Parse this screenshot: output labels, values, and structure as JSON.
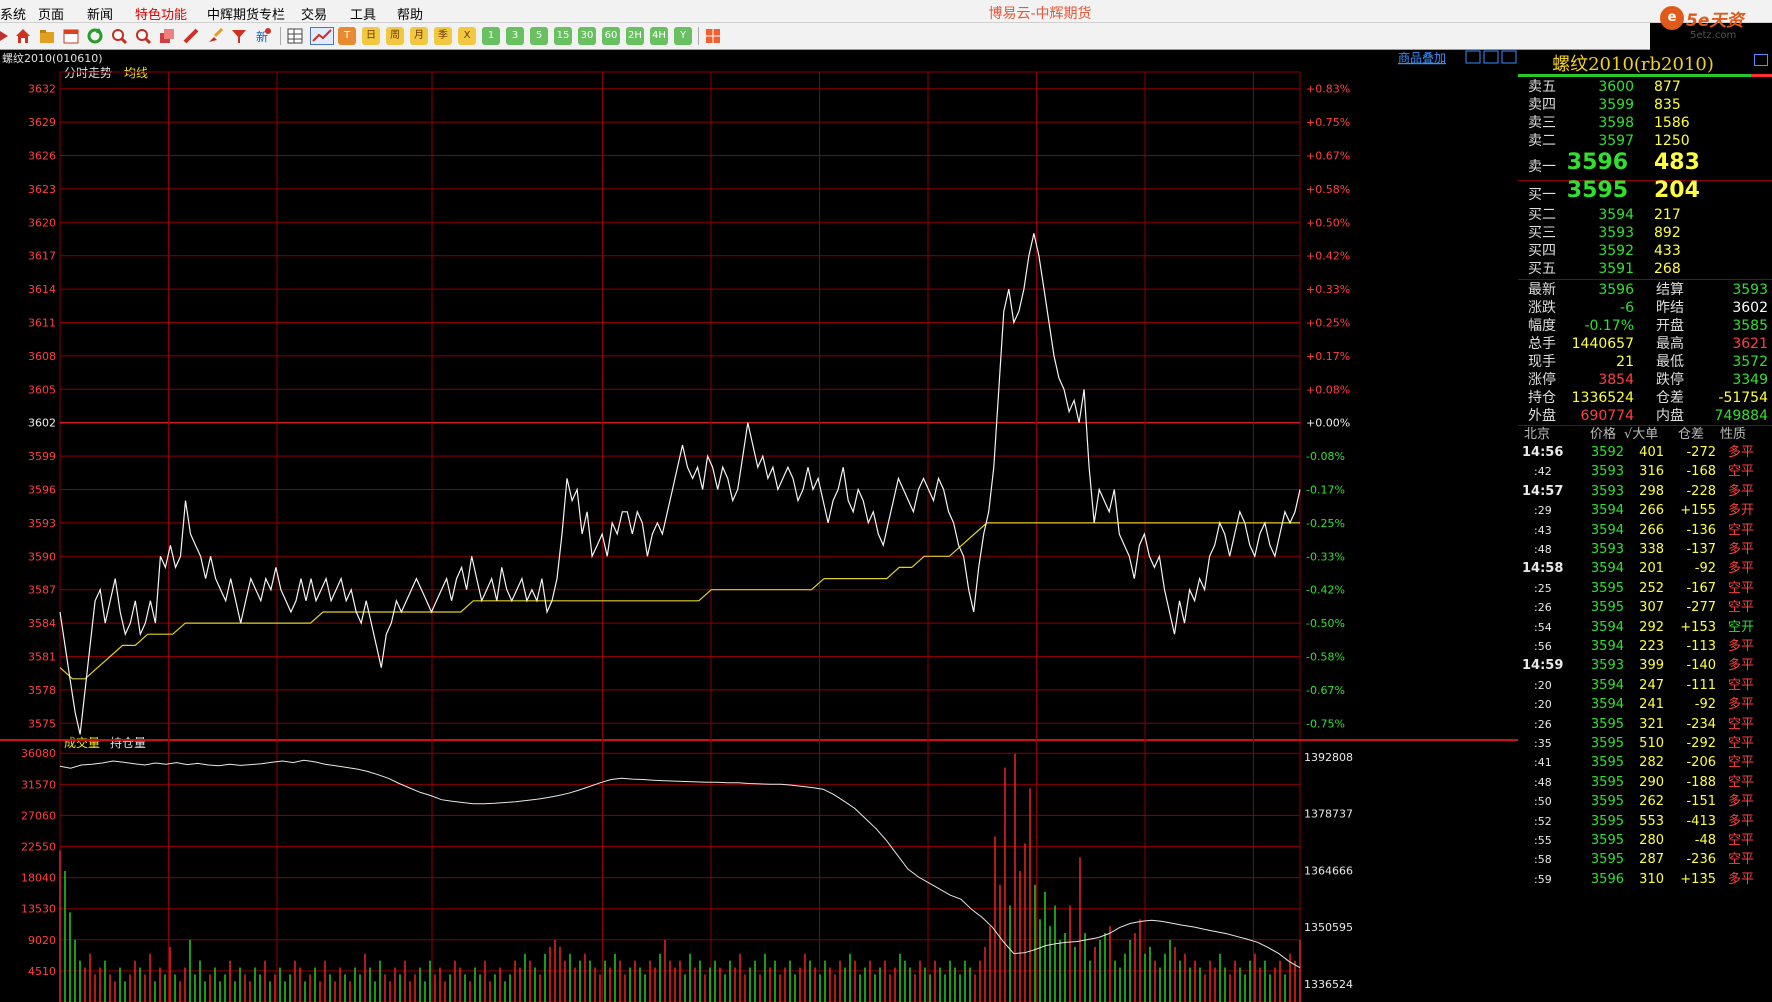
{
  "window": {
    "title": "博易云-中辉期货",
    "logo": {
      "main": "5e天资",
      "url": "5etz.com"
    }
  },
  "menu": [
    "系统",
    "页面",
    "新闻",
    "特色功能",
    "中辉期货专栏",
    "交易",
    "工具",
    "帮助"
  ],
  "toolbar": {
    "icons": [
      "home-icon",
      "folder-icon",
      "calendar-icon",
      "refresh-icon",
      "zoom-in-icon",
      "zoom-out-icon",
      "stack-icon",
      "pencil-icon",
      "brush-icon",
      "filter-icon",
      "new-icon",
      "table-icon",
      "trend-icon",
      "tick-icon"
    ],
    "periods": [
      "日",
      "周",
      "月",
      "季",
      "X",
      "1",
      "3",
      "5",
      "15",
      "30",
      "60",
      "2H",
      "4H",
      "Y"
    ]
  },
  "chart": {
    "contract_label": "螺纹2010(010610)",
    "overlay_link": "商品叠加",
    "price_legend": "分时走势",
    "avg_legend": "均线",
    "vol_legend": "成交量",
    "oi_legend": "持仓量",
    "price_ticks": [
      "3632",
      "3629",
      "3626",
      "3623",
      "3620",
      "3617",
      "3614",
      "3611",
      "3608",
      "3605",
      "3602",
      "3599",
      "3596",
      "3593",
      "3590",
      "3587",
      "3584",
      "3581",
      "3578",
      "3575"
    ],
    "pct_ticks": [
      "+0.83%",
      "+0.75%",
      "+0.67%",
      "+0.58%",
      "+0.50%",
      "+0.42%",
      "+0.33%",
      "+0.25%",
      "+0.17%",
      "+0.08%",
      "+0.00%",
      "-0.08%",
      "-0.17%",
      "-0.25%",
      "-0.33%",
      "-0.42%",
      "-0.50%",
      "-0.58%",
      "-0.67%",
      "-0.75%"
    ],
    "vol_ticks": [
      "36080",
      "31570",
      "27060",
      "22550",
      "18040",
      "13530",
      "9020",
      "4510"
    ],
    "oi_ticks": [
      "1392808",
      "1378737",
      "1364666",
      "1350595",
      "1336524"
    ]
  },
  "chart_data": {
    "type": "line",
    "ylim": [
      3573.5,
      3633.5
    ],
    "prev_settle": 3602,
    "price": [
      3585,
      3582,
      3579,
      3576,
      3574,
      3578,
      3582,
      3586,
      3587,
      3584,
      3586,
      3588,
      3585,
      3583,
      3584,
      3586,
      3583,
      3584,
      3586,
      3584,
      3590,
      3589,
      3591,
      3589,
      3590,
      3595,
      3592,
      3591,
      3590,
      3588,
      3590,
      3588,
      3587,
      3586,
      3588,
      3586,
      3584,
      3586,
      3588,
      3587,
      3586,
      3588,
      3587,
      3589,
      3587,
      3586,
      3585,
      3586,
      3588,
      3586,
      3588,
      3586,
      3587,
      3588,
      3586,
      3587,
      3588,
      3586,
      3587,
      3585,
      3584,
      3586,
      3584,
      3582,
      3580,
      3583,
      3584,
      3586,
      3585,
      3586,
      3587,
      3588,
      3587,
      3586,
      3585,
      3586,
      3587,
      3588,
      3586,
      3588,
      3589,
      3587,
      3590,
      3588,
      3586,
      3587,
      3588,
      3586,
      3589,
      3587,
      3586,
      3587,
      3588,
      3586,
      3587,
      3586,
      3588,
      3585,
      3586,
      3588,
      3592,
      3597,
      3595,
      3596,
      3592,
      3594,
      3590,
      3591,
      3592,
      3590,
      3593,
      3592,
      3594,
      3594,
      3592,
      3594,
      3593,
      3590,
      3592,
      3593,
      3592,
      3594,
      3596,
      3598,
      3600,
      3598,
      3597,
      3598,
      3596,
      3599,
      3598,
      3596,
      3598,
      3597,
      3595,
      3596,
      3599,
      3602,
      3600,
      3598,
      3599,
      3597,
      3598,
      3596,
      3597,
      3598,
      3597,
      3595,
      3596,
      3598,
      3596,
      3597,
      3595,
      3593,
      3595,
      3596,
      3598,
      3595,
      3594,
      3596,
      3595,
      3593,
      3594,
      3592,
      3591,
      3593,
      3595,
      3597,
      3596,
      3595,
      3594,
      3596,
      3597,
      3596,
      3595,
      3597,
      3596,
      3594,
      3593,
      3591,
      3590,
      3587,
      3585,
      3589,
      3592,
      3594,
      3598,
      3605,
      3612,
      3614,
      3611,
      3612,
      3614,
      3617,
      3619,
      3617,
      3614,
      3611,
      3608,
      3606,
      3605,
      3603,
      3604,
      3602,
      3605,
      3598,
      3593,
      3596,
      3595,
      3594,
      3596,
      3592,
      3591,
      3590,
      3588,
      3591,
      3592,
      3590,
      3589,
      3590,
      3587,
      3585,
      3583,
      3586,
      3584,
      3587,
      3586,
      3588,
      3587,
      3590,
      3591,
      3593,
      3592,
      3590,
      3592,
      3594,
      3593,
      3591,
      3590,
      3592,
      3593,
      3591,
      3590,
      3592,
      3594,
      3593,
      3594,
      3596
    ],
    "avg": [
      3580,
      3579,
      3579,
      3580,
      3581,
      3582,
      3582,
      3583,
      3583,
      3583,
      3584,
      3584,
      3584,
      3584,
      3584,
      3584,
      3584,
      3584,
      3584,
      3584,
      3584,
      3585,
      3585,
      3585,
      3585,
      3585,
      3585,
      3585,
      3585,
      3585,
      3585,
      3585,
      3585,
      3586,
      3586,
      3586,
      3586,
      3586,
      3586,
      3586,
      3586,
      3586,
      3586,
      3586,
      3586,
      3586,
      3586,
      3586,
      3586,
      3586,
      3586,
      3586,
      3587,
      3587,
      3587,
      3587,
      3587,
      3587,
      3587,
      3587,
      3587,
      3588,
      3588,
      3588,
      3588,
      3588,
      3588,
      3589,
      3589,
      3590,
      3590,
      3590,
      3591,
      3592,
      3593,
      3593,
      3593,
      3593,
      3593,
      3593,
      3593,
      3593,
      3593,
      3593,
      3593,
      3593,
      3593,
      3593,
      3593,
      3593,
      3593,
      3593,
      3593,
      3593,
      3593,
      3593,
      3593,
      3593,
      3593,
      3593
    ],
    "vol_ylim": [
      0,
      38000
    ],
    "volume": [
      22000,
      19000,
      13000,
      9000,
      6000,
      5000,
      7000,
      4000,
      5000,
      6000,
      4000,
      3000,
      5000,
      3000,
      4000,
      6000,
      5000,
      4000,
      7000,
      3000,
      5000,
      4000,
      8000,
      4000,
      3000,
      5000,
      9000,
      4000,
      6000,
      3000,
      4000,
      5000,
      3000,
      4000,
      6000,
      3000,
      5000,
      4000,
      3000,
      5000,
      4000,
      6000,
      3000,
      4000,
      5000,
      3000,
      4000,
      6000,
      5000,
      3000,
      4000,
      5000,
      3000,
      6000,
      4000,
      3000,
      5000,
      4000,
      3000,
      5000,
      4000,
      7000,
      5000,
      3000,
      6000,
      4000,
      3000,
      5000,
      4000,
      6000,
      3000,
      4000,
      5000,
      3000,
      6000,
      4000,
      5000,
      3000,
      4000,
      6000,
      5000,
      4000,
      3000,
      5000,
      4000,
      6000,
      3000,
      4000,
      5000,
      3000,
      4000,
      6000,
      5000,
      7000,
      6000,
      5000,
      4000,
      7000,
      8000,
      9000,
      8000,
      6000,
      7000,
      5000,
      6000,
      7000,
      6000,
      5000,
      4000,
      6000,
      5000,
      7000,
      6000,
      4000,
      5000,
      6000,
      5000,
      4000,
      6000,
      5000,
      7000,
      9000,
      6000,
      5000,
      6000,
      4000,
      7000,
      5000,
      6000,
      4000,
      5000,
      6000,
      5000,
      4000,
      6000,
      5000,
      7000,
      4000,
      5000,
      6000,
      4000,
      7000,
      5000,
      6000,
      4000,
      5000,
      6000,
      4000,
      5000,
      7000,
      6000,
      5000,
      4000,
      6000,
      5000,
      4000,
      6000,
      5000,
      7000,
      6000,
      4000,
      5000,
      6000,
      4000,
      5000,
      6000,
      4000,
      5000,
      7000,
      6000,
      5000,
      4000,
      6000,
      5000,
      4000,
      6000,
      5000,
      4000,
      6000,
      5000,
      4000,
      6000,
      5000,
      4000,
      6000,
      8000,
      11000,
      24000,
      17000,
      34000,
      14000,
      36000,
      19000,
      23000,
      31000,
      17000,
      12000,
      16000,
      11000,
      14000,
      9000,
      10000,
      14000,
      8000,
      21000,
      10000,
      6000,
      8000,
      9000,
      10000,
      11000,
      6000,
      5000,
      7000,
      9000,
      10000,
      12000,
      7000,
      8000,
      6000,
      5000,
      7000,
      9000,
      8000,
      6000,
      7000,
      5000,
      6000,
      5000,
      4000,
      6000,
      5000,
      7000,
      5000,
      4000,
      6000,
      5000,
      4000,
      6000,
      7000,
      5000,
      6000,
      4000,
      5000,
      6000,
      4000,
      7000,
      6000,
      9000
    ],
    "oi_ylim": [
      1332000,
      1397000
    ],
    "open_interest": [
      1390500,
      1390000,
      1390800,
      1391000,
      1391300,
      1391800,
      1391500,
      1391100,
      1390800,
      1391300,
      1391000,
      1391400,
      1390900,
      1391200,
      1390800,
      1390600,
      1391000,
      1390700,
      1390900,
      1391100,
      1391500,
      1391800,
      1391400,
      1392000,
      1391600,
      1391000,
      1390600,
      1390200,
      1389800,
      1389200,
      1388400,
      1387500,
      1386200,
      1385100,
      1384000,
      1383200,
      1382200,
      1381800,
      1381500,
      1381200,
      1381200,
      1381300,
      1381500,
      1381700,
      1382000,
      1382300,
      1382700,
      1383200,
      1383800,
      1384600,
      1385500,
      1386400,
      1387200,
      1387500,
      1387300,
      1387200,
      1387000,
      1386900,
      1386800,
      1386700,
      1386600,
      1386500,
      1386500,
      1386400,
      1386400,
      1386200,
      1386100,
      1386000,
      1386000,
      1385800,
      1385500,
      1385200,
      1384800,
      1383500,
      1381800,
      1380000,
      1377500,
      1375000,
      1372000,
      1368500,
      1365000,
      1363000,
      1361500,
      1360000,
      1358500,
      1357500,
      1355000,
      1353000,
      1350500,
      1347000,
      1344000,
      1344200,
      1345000,
      1346000,
      1346500,
      1346800,
      1347000,
      1347500,
      1348000,
      1349000,
      1350500,
      1351500,
      1352000,
      1352300,
      1352000,
      1351500,
      1351000,
      1350600,
      1350000,
      1349500,
      1349000,
      1348300,
      1347600,
      1346800,
      1345500,
      1344000,
      1342000,
      1340500
    ]
  },
  "quote": {
    "title": "螺纹2010(rb2010)",
    "asks": [
      {
        "label": "卖五",
        "price": "3600",
        "vol": "877"
      },
      {
        "label": "卖四",
        "price": "3599",
        "vol": "835"
      },
      {
        "label": "卖三",
        "price": "3598",
        "vol": "1586"
      },
      {
        "label": "卖二",
        "price": "3597",
        "vol": "1250"
      },
      {
        "label": "卖一",
        "price": "3596",
        "vol": "483"
      }
    ],
    "bids": [
      {
        "label": "买一",
        "price": "3595",
        "vol": "204"
      },
      {
        "label": "买二",
        "price": "3594",
        "vol": "217"
      },
      {
        "label": "买三",
        "price": "3593",
        "vol": "892"
      },
      {
        "label": "买四",
        "price": "3592",
        "vol": "433"
      },
      {
        "label": "买五",
        "price": "3591",
        "vol": "268"
      }
    ],
    "stats": [
      {
        "l1": "最新",
        "v1": "3596",
        "c1": "#30e030",
        "l2": "结算",
        "v2": "3593",
        "c2": "#30e030"
      },
      {
        "l1": "涨跌",
        "v1": "-6",
        "c1": "#30e030",
        "l2": "昨结",
        "v2": "3602",
        "c2": "#ffffff"
      },
      {
        "l1": "幅度",
        "v1": "-0.17%",
        "c1": "#30e030",
        "l2": "开盘",
        "v2": "3585",
        "c2": "#30e030"
      },
      {
        "l1": "总手",
        "v1": "1440657",
        "c1": "#ffff40",
        "l2": "最高",
        "v2": "3621",
        "c2": "#ff4040"
      },
      {
        "l1": "现手",
        "v1": "21",
        "c1": "#ffff40",
        "l2": "最低",
        "v2": "3572",
        "c2": "#30e030"
      },
      {
        "l1": "涨停",
        "v1": "3854",
        "c1": "#ff4040",
        "l2": "跌停",
        "v2": "3349",
        "c2": "#30e030"
      },
      {
        "l1": "持仓",
        "v1": "1336524",
        "c1": "#ffff40",
        "l2": "仓差",
        "v2": "-51754",
        "c2": "#ffff40"
      },
      {
        "l1": "外盘",
        "v1": "690774",
        "c1": "#ff4040",
        "l2": "内盘",
        "v2": "749884",
        "c2": "#30e030"
      }
    ],
    "ticks_header": {
      "time": "北京",
      "price": "价格",
      "vol": "√大单",
      "oi": "仓差",
      "nature": "性质"
    },
    "ticks": [
      {
        "time": "14:56",
        "price": "3592",
        "vol": "401",
        "oi": "-272",
        "nature": "多平",
        "nc": "#ff4040"
      },
      {
        "time": ":42",
        "price": "3593",
        "vol": "316",
        "oi": "-168",
        "nature": "空平",
        "nc": "#ff4040"
      },
      {
        "time": "14:57",
        "price": "3593",
        "vol": "298",
        "oi": "-228",
        "nature": "多平",
        "nc": "#ff4040"
      },
      {
        "time": ":29",
        "price": "3594",
        "vol": "266",
        "oi": "+155",
        "nature": "多开",
        "nc": "#ff4040"
      },
      {
        "time": ":43",
        "price": "3594",
        "vol": "266",
        "oi": "-136",
        "nature": "空平",
        "nc": "#ff4040"
      },
      {
        "time": ":48",
        "price": "3593",
        "vol": "338",
        "oi": "-137",
        "nature": "多平",
        "nc": "#ff4040"
      },
      {
        "time": "14:58",
        "price": "3594",
        "vol": "201",
        "oi": "-92",
        "nature": "多平",
        "nc": "#ff4040"
      },
      {
        "time": ":25",
        "price": "3595",
        "vol": "252",
        "oi": "-167",
        "nature": "空平",
        "nc": "#ff4040"
      },
      {
        "time": ":26",
        "price": "3595",
        "vol": "307",
        "oi": "-277",
        "nature": "空平",
        "nc": "#ff4040"
      },
      {
        "time": ":54",
        "price": "3594",
        "vol": "292",
        "oi": "+153",
        "nature": "空开",
        "nc": "#30e030"
      },
      {
        "time": ":56",
        "price": "3594",
        "vol": "223",
        "oi": "-113",
        "nature": "多平",
        "nc": "#ff4040"
      },
      {
        "time": "14:59",
        "price": "3593",
        "vol": "399",
        "oi": "-140",
        "nature": "多平",
        "nc": "#ff4040"
      },
      {
        "time": ":20",
        "price": "3594",
        "vol": "247",
        "oi": "-111",
        "nature": "空平",
        "nc": "#ff4040"
      },
      {
        "time": ":20",
        "price": "3594",
        "vol": "241",
        "oi": "-92",
        "nature": "多平",
        "nc": "#ff4040"
      },
      {
        "time": ":26",
        "price": "3595",
        "vol": "321",
        "oi": "-234",
        "nature": "空平",
        "nc": "#ff4040"
      },
      {
        "time": ":35",
        "price": "3595",
        "vol": "510",
        "oi": "-292",
        "nature": "空平",
        "nc": "#ff4040"
      },
      {
        "time": ":41",
        "price": "3595",
        "vol": "282",
        "oi": "-206",
        "nature": "空平",
        "nc": "#ff4040"
      },
      {
        "time": ":48",
        "price": "3595",
        "vol": "290",
        "oi": "-188",
        "nature": "空平",
        "nc": "#ff4040"
      },
      {
        "time": ":50",
        "price": "3595",
        "vol": "262",
        "oi": "-151",
        "nature": "多平",
        "nc": "#ff4040"
      },
      {
        "time": ":52",
        "price": "3595",
        "vol": "553",
        "oi": "-413",
        "nature": "多平",
        "nc": "#ff4040"
      },
      {
        "time": ":55",
        "price": "3595",
        "vol": "280",
        "oi": "-48",
        "nature": "空平",
        "nc": "#ff4040"
      },
      {
        "time": ":58",
        "price": "3595",
        "vol": "287",
        "oi": "-236",
        "nature": "空平",
        "nc": "#ff4040"
      },
      {
        "time": ":59",
        "price": "3596",
        "vol": "310",
        "oi": "+135",
        "nature": "多平",
        "nc": "#ff4040"
      }
    ]
  }
}
